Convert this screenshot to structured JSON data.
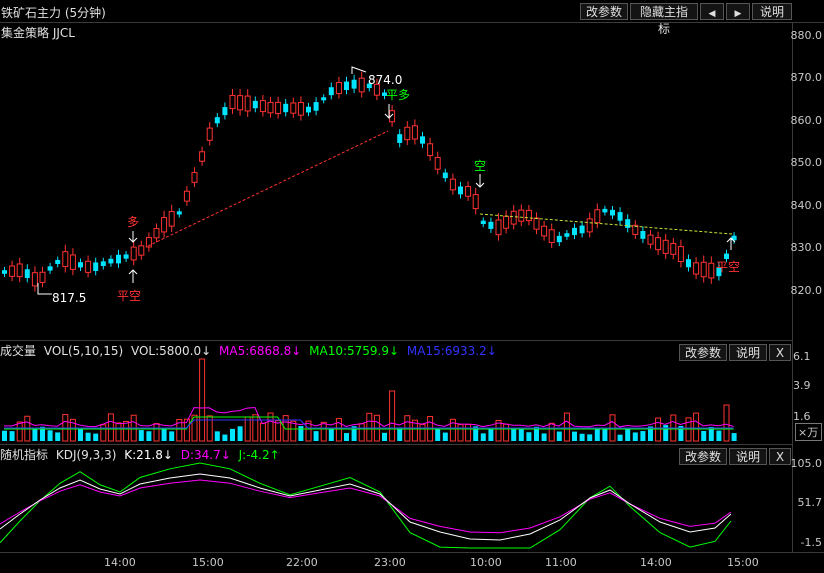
{
  "title": "铁矿石主力 (5分钟)",
  "strategy": "集金策略 JJCL",
  "toolbar": {
    "params": "改参数",
    "hide": "隐藏主指标",
    "prev": "◀",
    "next": "▶",
    "help": "说明"
  },
  "price_axis": [
    "880.0",
    "870.0",
    "860.0",
    "850.0",
    "840.0",
    "830.0",
    "820.0"
  ],
  "annotations": {
    "high": "874.0",
    "low": "817.5",
    "duo": "多",
    "pingduo": "平多",
    "kong": "空",
    "pingkong1": "平空",
    "pingkong2": "平空"
  },
  "volume": {
    "label": "成交量",
    "vol": "VOL(5,10,15)",
    "volval": "VOL:5800.0↓",
    "ma5": "MA5:6868.8↓",
    "ma10": "MA10:5759.9↓",
    "ma15": "MA15:6933.2↓",
    "params": "改参数",
    "help": "说明",
    "close": "X",
    "axis": [
      "6.1",
      "3.9",
      "1.6"
    ],
    "unit": "×万"
  },
  "kdj": {
    "label": "随机指标",
    "name": "KDJ(9,3,3)",
    "k": "K:21.8↓",
    "d": "D:34.7↓",
    "j": "J:-4.2↑",
    "params": "改参数",
    "help": "说明",
    "close": "X",
    "axis": [
      "105.0",
      "51.7",
      "-1.5"
    ]
  },
  "time_axis": [
    "14:00",
    "15:00",
    "22:00",
    "23:00",
    "10:00",
    "11:00",
    "14:00",
    "15:00"
  ],
  "colors": {
    "up": "#ff3232",
    "down": "#00e4ff",
    "k": "#ffffff",
    "d": "#ff00ff",
    "j": "#00ff00"
  }
}
